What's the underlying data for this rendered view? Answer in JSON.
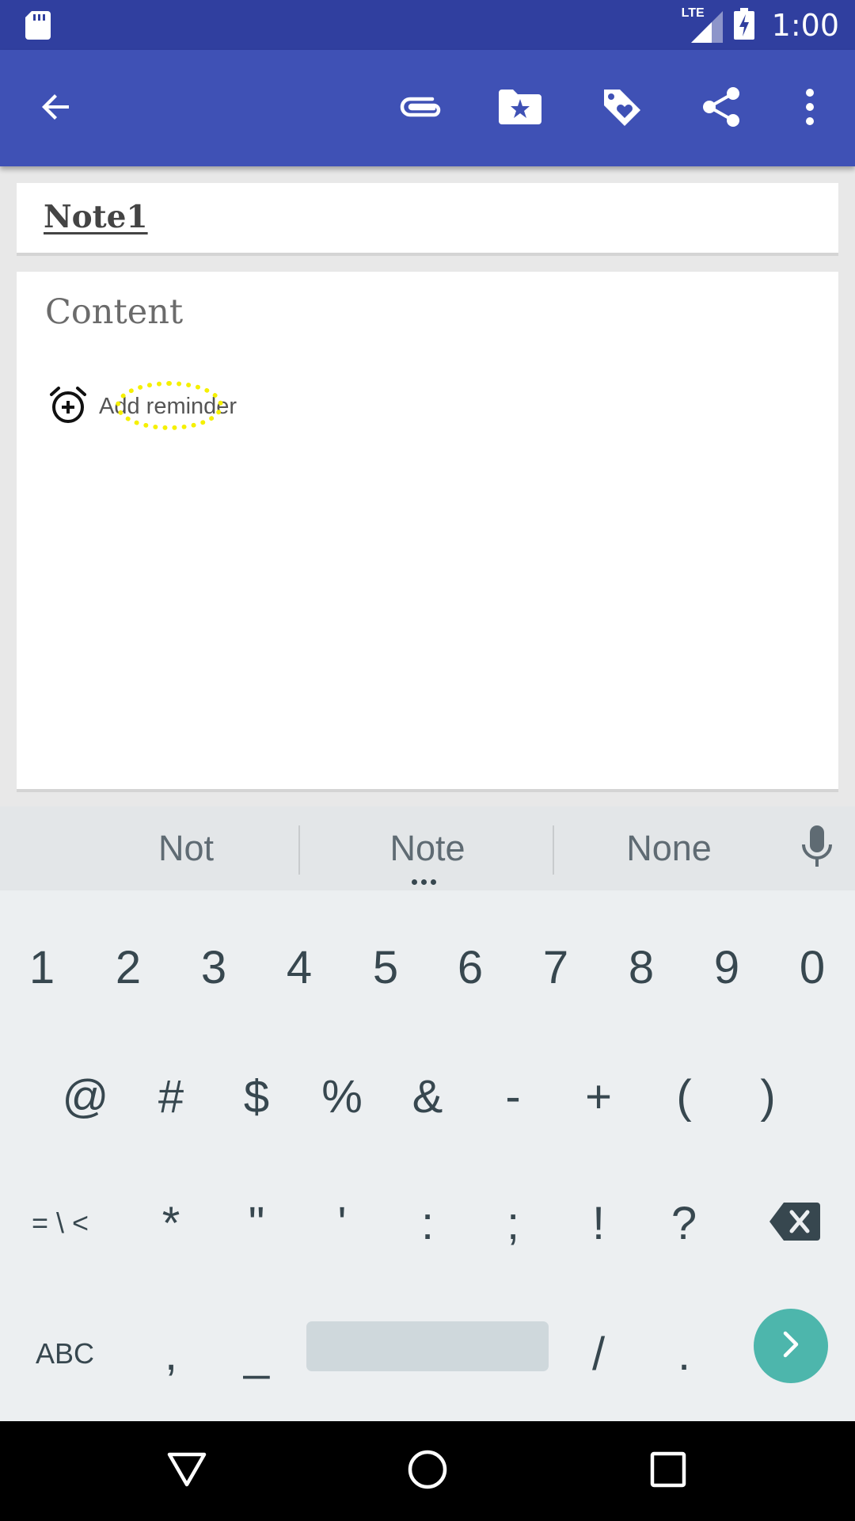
{
  "status_bar": {
    "network_label": "LTE",
    "time": "1:00",
    "icons": [
      "sd-card-icon",
      "signal-icon",
      "battery-charging-icon"
    ]
  },
  "toolbar": {
    "icons": [
      "back-arrow-icon",
      "attachment-icon",
      "folder-star-icon",
      "tag-heart-icon",
      "share-icon",
      "more-vert-icon"
    ]
  },
  "note": {
    "title": "Note1",
    "content_placeholder": "Content",
    "reminder_label": "Add reminder",
    "reminder_icon": "alarm-add-icon"
  },
  "keyboard": {
    "suggestions": [
      "Not",
      "Note",
      "None"
    ],
    "mic_icon": "mic-icon",
    "row1": [
      "1",
      "2",
      "3",
      "4",
      "5",
      "6",
      "7",
      "8",
      "9",
      "0"
    ],
    "row2": [
      "@",
      "#",
      "$",
      "%",
      "&",
      "-",
      "+",
      "(",
      ")"
    ],
    "row3": [
      "= \\ <",
      "*",
      "\"",
      "'",
      ":",
      ";",
      "!",
      "?"
    ],
    "backspace_icon": "backspace-icon",
    "row4": {
      "abc_label": "ABC",
      "comma": ",",
      "underscore": "_",
      "slash": "/",
      "period": ".",
      "enter_icon": "chevron-right-icon"
    },
    "enter_color": "#4db6ac"
  },
  "nav_bar": {
    "icons": [
      "nav-back-icon",
      "nav-home-icon",
      "nav-recents-icon"
    ]
  },
  "colors": {
    "status_bar": "#303f9f",
    "app_bar": "#3f51b5",
    "highlight": "#f5f000"
  }
}
